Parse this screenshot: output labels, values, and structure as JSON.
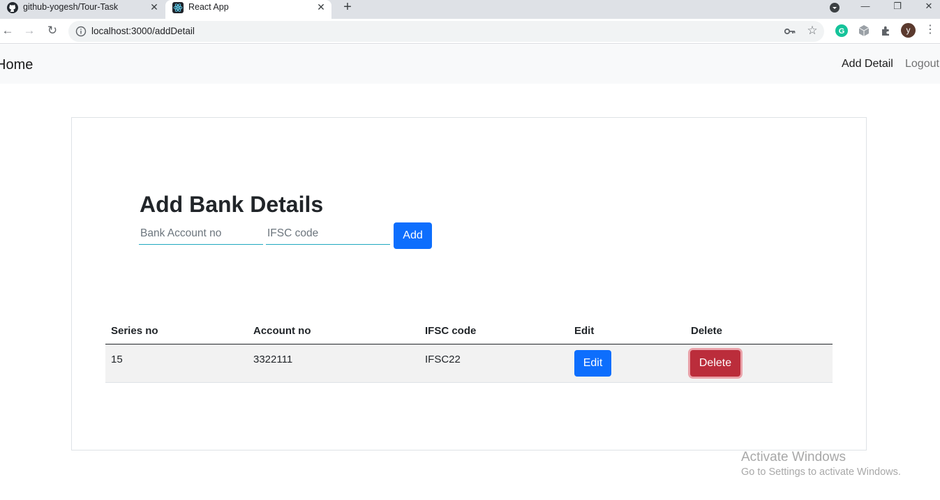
{
  "browser": {
    "tabs": [
      {
        "title": "github-yogesh/Tour-Task",
        "icon": "github-icon"
      },
      {
        "title": "React App",
        "icon": "react-icon"
      }
    ],
    "url": "localhost:3000/addDetail",
    "profile_initial": "y"
  },
  "navbar": {
    "brand": "Home",
    "links": [
      "Add Detail",
      "Logout"
    ]
  },
  "form": {
    "title": "Add Bank Details",
    "account_placeholder": "Bank Account no",
    "ifsc_placeholder": "IFSC code",
    "add_label": "Add"
  },
  "table": {
    "headers": [
      "Series no",
      "Account no",
      "IFSC code",
      "Edit",
      "Delete"
    ],
    "rows": [
      {
        "series": "15",
        "account": "3322111",
        "ifsc": "IFSC22",
        "edit_label": "Edit",
        "delete_label": "Delete"
      }
    ]
  },
  "watermark": {
    "line1": "Activate Windows",
    "line2": "Go to Settings to activate Windows."
  },
  "colors": {
    "primary": "#0d6efd",
    "danger": "#bb2d3b",
    "navbar_bg": "#f8f9fa",
    "input_underline": "#20a8c0"
  }
}
